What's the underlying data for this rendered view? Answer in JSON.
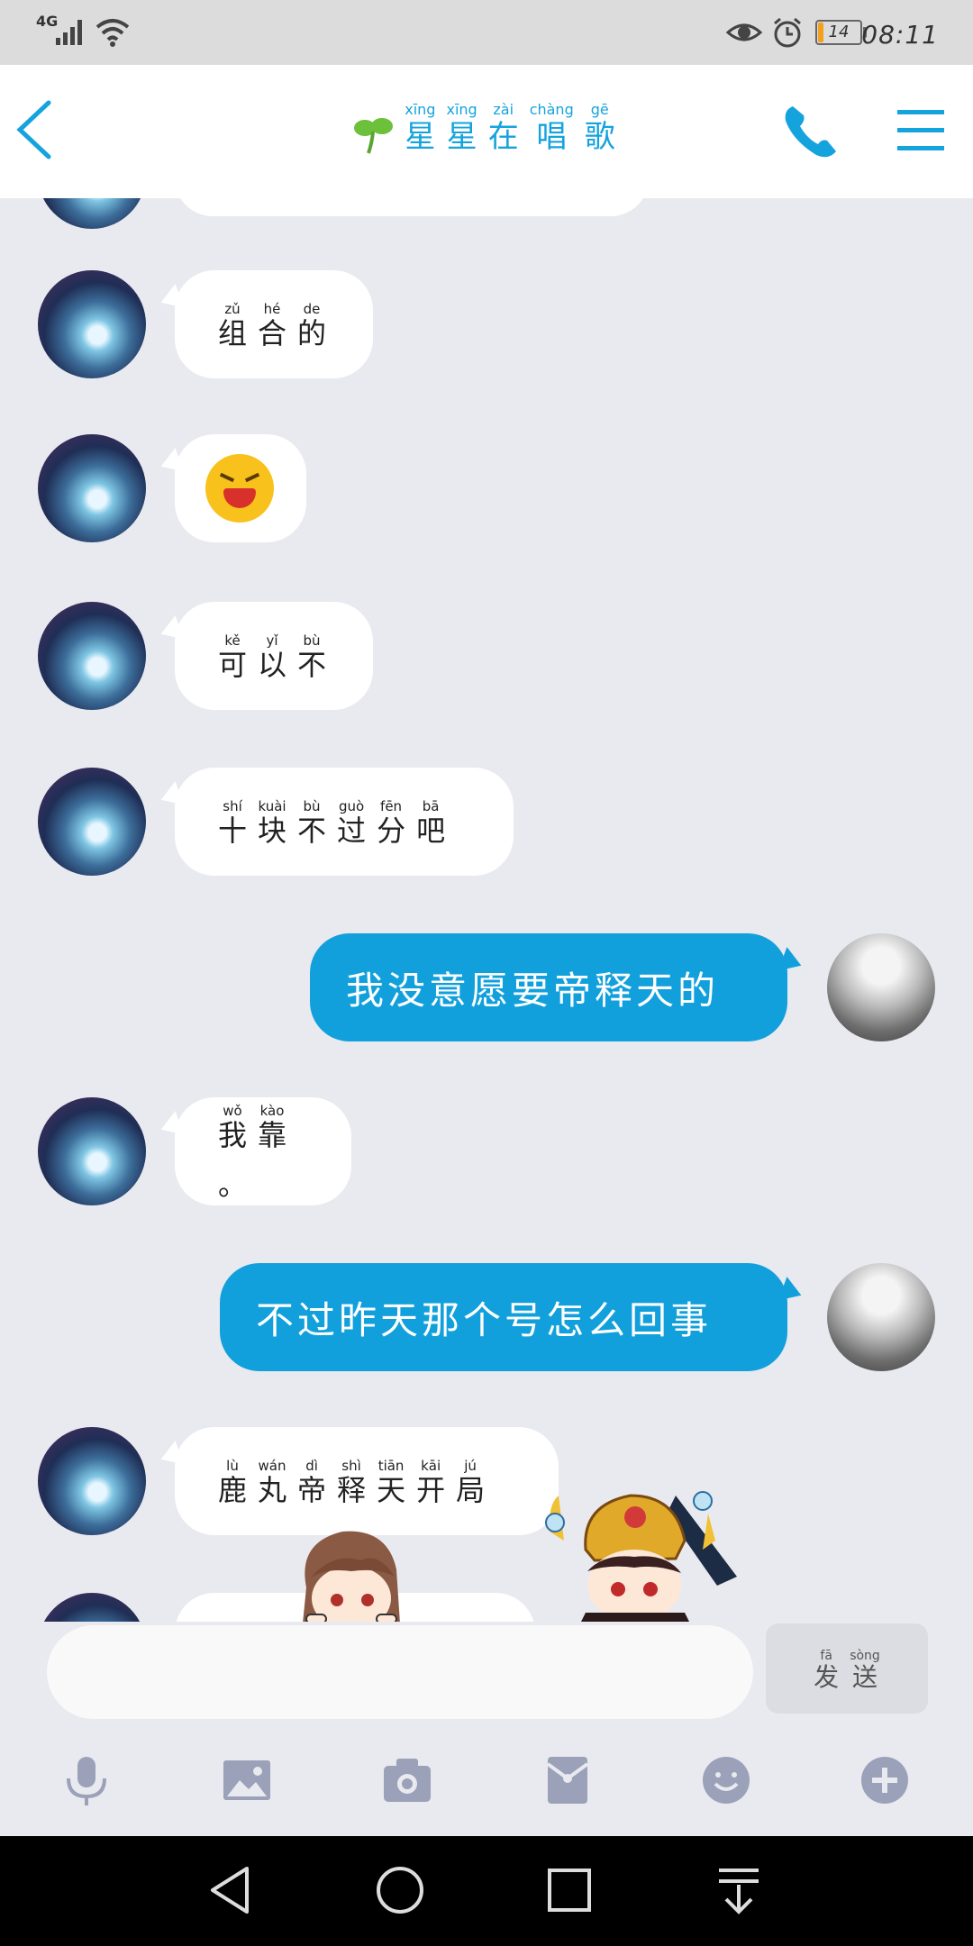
{
  "status_bar": {
    "network": "4G",
    "battery_percent": 14,
    "battery_label": "14",
    "time": "08:11"
  },
  "header": {
    "title": [
      {
        "py": "xīng",
        "hz": "星"
      },
      {
        "py": "xīng",
        "hz": "星"
      },
      {
        "py": "zài",
        "hz": "在"
      },
      {
        "py": "chàng",
        "hz": "唱"
      },
      {
        "py": "gē",
        "hz": "歌"
      }
    ]
  },
  "messages": [
    {
      "side": "in",
      "kind": "text",
      "ruby": [
        {
          "py": "zǔ",
          "hz": "组"
        },
        {
          "py": "hé",
          "hz": "合"
        },
        {
          "py": "de",
          "hz": "的"
        }
      ]
    },
    {
      "side": "in",
      "kind": "emoji",
      "emoji": "crying-laughing-face"
    },
    {
      "side": "in",
      "kind": "text",
      "ruby": [
        {
          "py": "kě",
          "hz": "可"
        },
        {
          "py": "yǐ",
          "hz": "以"
        },
        {
          "py": "bù",
          "hz": "不"
        }
      ]
    },
    {
      "side": "in",
      "kind": "text",
      "ruby": [
        {
          "py": "shí",
          "hz": "十"
        },
        {
          "py": "kuài",
          "hz": "块"
        },
        {
          "py": "bù",
          "hz": "不"
        },
        {
          "py": "guò",
          "hz": "过"
        },
        {
          "py": "fēn",
          "hz": "分"
        },
        {
          "py": "bā",
          "hz": "吧"
        }
      ]
    },
    {
      "side": "out",
      "kind": "text",
      "text": "我没意愿要帝释天的"
    },
    {
      "side": "in",
      "kind": "text",
      "ruby": [
        {
          "py": "wǒ",
          "hz": "我"
        },
        {
          "py": "kào",
          "hz": "靠"
        },
        {
          "py": "",
          "hz": "。"
        }
      ]
    },
    {
      "side": "out",
      "kind": "text",
      "text": "不过昨天那个号怎么回事"
    },
    {
      "side": "in",
      "kind": "text",
      "ruby": [
        {
          "py": "lù",
          "hz": "鹿"
        },
        {
          "py": "wán",
          "hz": "丸"
        },
        {
          "py": "dì",
          "hz": "帝"
        },
        {
          "py": "shì",
          "hz": "释"
        },
        {
          "py": "tiān",
          "hz": "天"
        },
        {
          "py": "kāi",
          "hz": "开"
        },
        {
          "py": "jú",
          "hz": "局"
        }
      ]
    }
  ],
  "input": {
    "value": ""
  },
  "send_button": [
    {
      "py": "fā",
      "hz": "发"
    },
    {
      "py": "sòng",
      "hz": "送"
    }
  ],
  "toolbar": [
    "microphone-icon",
    "image-icon",
    "camera-icon",
    "red-packet-icon",
    "emoji-icon",
    "plus-icon"
  ],
  "colors": {
    "accent": "#12a0dc",
    "background": "#e9eaef",
    "header": "#ffffff"
  }
}
